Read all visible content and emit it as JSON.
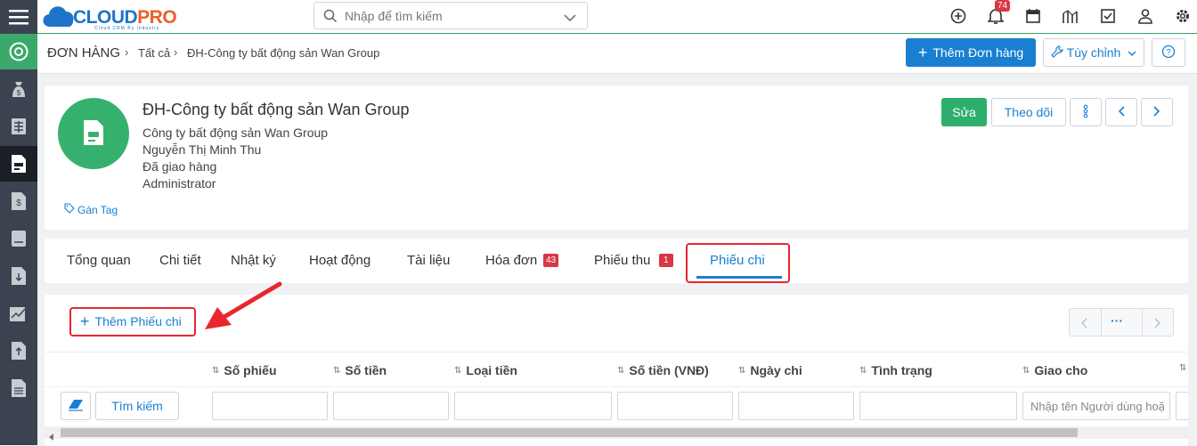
{
  "app": {
    "logo_text_blue": "CLOUD",
    "logo_text_orange": "PRO",
    "logo_tagline": "Cloud CRM By Industry"
  },
  "search": {
    "placeholder": "Nhập để tìm kiếm"
  },
  "header": {
    "notification_count": "74"
  },
  "icons": [
    "menu-icon",
    "plus-circle-icon",
    "bell-icon",
    "calendar-icon",
    "chart-icon",
    "checkbox-icon",
    "user-icon",
    "gear-icon",
    "search-icon",
    "chevron-down-icon"
  ],
  "breadcrumb": {
    "module": "ĐƠN HÀNG",
    "all": "Tất cả",
    "current": "ĐH-Công ty bất động sản Wan Group"
  },
  "toolbar": {
    "add_label": "Thêm Đơn hàng",
    "customize_label": "Tùy chỉnh"
  },
  "record": {
    "title": "ĐH-Công ty bất động sản Wan Group",
    "company": "Công ty bất động sản Wan Group",
    "contact": "Nguyễn Thị Minh Thu",
    "status": "Đã giao hàng",
    "owner": "Administrator",
    "tag_label": "Gán Tag",
    "edit_label": "Sửa",
    "follow_label": "Theo dõi"
  },
  "tabs": [
    {
      "label": "Tổng quan"
    },
    {
      "label": "Chi tiết"
    },
    {
      "label": "Nhật ký"
    },
    {
      "label": "Hoạt động"
    },
    {
      "label": "Tài liệu"
    },
    {
      "label": "Hóa đơn",
      "badge": "43"
    },
    {
      "label": "Phiếu thu",
      "badge": "1"
    },
    {
      "label": "Phiếu chi",
      "active": true
    }
  ],
  "panel": {
    "add_label": "Thêm Phiếu chi",
    "pager_more": "···",
    "search_button": "Tìm kiếm",
    "columns": [
      "Số phiếu",
      "Số tiền",
      "Loại tiền",
      "Số tiền (VNĐ)",
      "Ngày chi",
      "Tình trạng",
      "Giao cho"
    ],
    "assignee_placeholder": "Nhập tên Người dùng hoặc Nhóm"
  },
  "colors": {
    "primary": "#1a7fd1",
    "green": "#2eae6c",
    "badge_red": "#d93646",
    "highlight_red": "#e8262d",
    "sidebar": "#3c4350"
  }
}
